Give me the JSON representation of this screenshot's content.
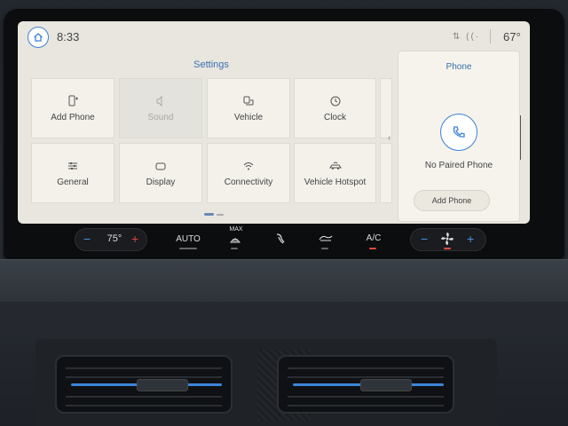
{
  "status": {
    "time": "8:33",
    "outside_temp": "67°"
  },
  "settings": {
    "title": "Settings",
    "tiles": [
      {
        "label": "Add Phone",
        "icon": "add-phone-icon",
        "disabled": false
      },
      {
        "label": "Sound",
        "icon": "speaker-icon",
        "disabled": true
      },
      {
        "label": "Vehicle",
        "icon": "vehicle-icon",
        "disabled": false
      },
      {
        "label": "Clock",
        "icon": "clock-icon",
        "disabled": false
      },
      {
        "label": "General",
        "icon": "sliders-icon",
        "disabled": false
      },
      {
        "label": "Display",
        "icon": "display-icon",
        "disabled": false
      },
      {
        "label": "Connectivity",
        "icon": "wifi-icon",
        "disabled": false
      },
      {
        "label": "Vehicle Hotspot",
        "icon": "hotspot-icon",
        "disabled": false
      }
    ]
  },
  "phone": {
    "title": "Phone",
    "status": "No Paired Phone",
    "add_button": "Add Phone"
  },
  "climate": {
    "minus": "−",
    "plus": "+",
    "driver_temp": "75°",
    "auto": "AUTO",
    "max": "MAX",
    "ac": "A/C",
    "fan_minus": "−",
    "fan_plus": "+",
    "accent_blue": "#3b82d6",
    "accent_red": "#e04040"
  }
}
